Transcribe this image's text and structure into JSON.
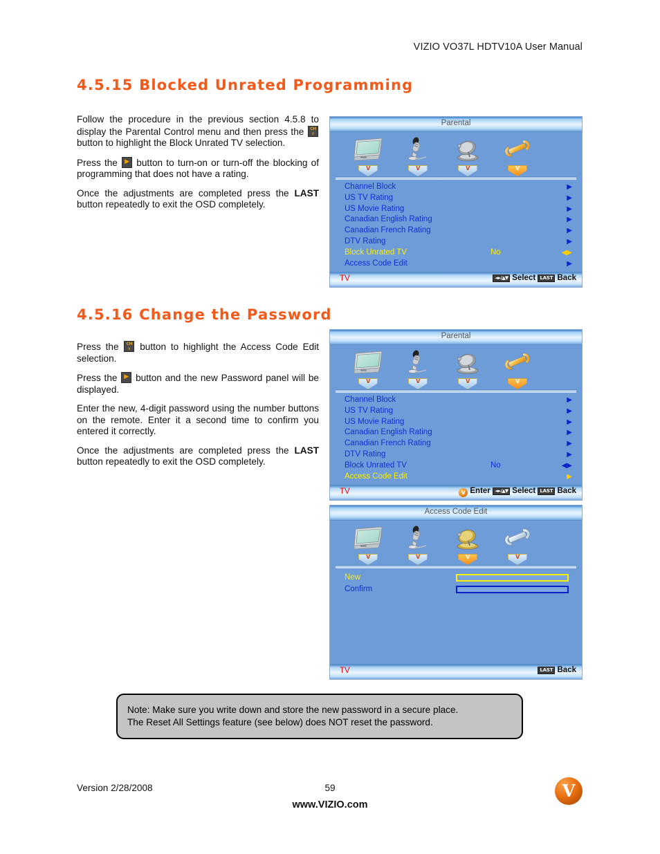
{
  "page_header": "VIZIO VO37L HDTV10A User Manual",
  "sections": [
    {
      "heading": "4.5.15 Blocked Unrated Programming",
      "paragraphs": [
        "Follow the procedure in the previous section 4.5.8 to display the Parental Control menu and then press the  button to highlight the Block Unrated TV selection.",
        "Press the  button to turn-on or turn-off the blocking of programming that does not have a rating.",
        "Once the adjustments are completed press the LAST button repeatedly to exit the OSD completely."
      ]
    },
    {
      "heading": "4.5.16 Change the Password",
      "paragraphs": [
        "Press the  button to highlight the Access Code Edit selection.",
        "Press the  button and the new Password panel will be displayed.",
        "Enter the new, 4-digit password using the number buttons on the remote.  Enter it a second time to confirm you entered it correctly.",
        "Once the adjustments are completed press the LAST button repeatedly to exit the OSD completely."
      ]
    }
  ],
  "text1": {
    "p1_a": "Follow the procedure in the previous section 4.5.8 to display the Parental Control menu and then press the",
    "p1_b": "button to highlight the Block Unrated TV selection.",
    "p2_a": "Press the",
    "p2_b": "button to turn-on or turn-off the blocking of programming that does not have a rating.",
    "p3_a": "Once the adjustments are completed press the",
    "p3_bold": "LAST",
    "p3_b": "button repeatedly to exit the OSD completely."
  },
  "text2": {
    "p1_a": "Press the",
    "p1_b": "button to highlight the Access Code Edit selection.",
    "p2_a": "Press the",
    "p2_b": "button and the new Password panel will be displayed.",
    "p3": "Enter the new, 4-digit password using the number buttons on the remote.  Enter it a second time to confirm you entered it correctly.",
    "p4_a": "Once the adjustments are completed press the",
    "p4_bold": "LAST",
    "p4_b": "button repeatedly to exit the OSD completely."
  },
  "osd_common": {
    "icon_tabs": [
      "V",
      "V",
      "V",
      "V"
    ],
    "icons": [
      "tv-monitor-icon",
      "microphone-icon",
      "satellite-dish-icon",
      "wrench-icon"
    ],
    "status_tv": "TV",
    "key_arrows": "◄►/▲▼",
    "key_last": "LAST",
    "hint_select": "Select",
    "hint_back": "Back",
    "hint_enter": "Enter",
    "enter_glyph": "V"
  },
  "osd1": {
    "title": "Parental",
    "active_icon_index": 3,
    "rows": [
      {
        "label": "Channel Block",
        "value": "",
        "arrow": "▶",
        "selected": false
      },
      {
        "label": "US TV Rating",
        "value": "",
        "arrow": "▶",
        "selected": false
      },
      {
        "label": "US Movie Rating",
        "value": "",
        "arrow": "▶",
        "selected": false
      },
      {
        "label": "Canadian English Rating",
        "value": "",
        "arrow": "▶",
        "selected": false
      },
      {
        "label": "Canadian French Rating",
        "value": "",
        "arrow": "▶",
        "selected": false
      },
      {
        "label": "DTV Rating",
        "value": "",
        "arrow": "▶",
        "selected": false
      },
      {
        "label": "Block Unrated TV",
        "value": "No",
        "arrow": "◀▶",
        "selected": true
      },
      {
        "label": "Access Code Edit",
        "value": "",
        "arrow": "▶",
        "selected": false
      }
    ]
  },
  "osd2": {
    "title": "Parental",
    "active_icon_index": 3,
    "rows": [
      {
        "label": "Channel Block",
        "value": "",
        "arrow": "▶",
        "selected": false
      },
      {
        "label": "US TV Rating",
        "value": "",
        "arrow": "▶",
        "selected": false
      },
      {
        "label": "US Movie Rating",
        "value": "",
        "arrow": "▶",
        "selected": false
      },
      {
        "label": "Canadian English Rating",
        "value": "",
        "arrow": "▶",
        "selected": false
      },
      {
        "label": "Canadian French Rating",
        "value": "",
        "arrow": "▶",
        "selected": false
      },
      {
        "label": "DTV Rating",
        "value": "",
        "arrow": "▶",
        "selected": false
      },
      {
        "label": "Block Unrated TV",
        "value": "No",
        "arrow": "◀▶",
        "selected": false
      },
      {
        "label": "Access Code Edit",
        "value": "",
        "arrow": "▶",
        "selected": true
      }
    ]
  },
  "osd3": {
    "title": "Access Code Edit",
    "active_icon_index": 2,
    "rows": [
      {
        "label": "New",
        "selected": true,
        "field_color": "#FFF000"
      },
      {
        "label": "Confirm",
        "selected": false,
        "field_color": "#0a22c8"
      }
    ]
  },
  "note": {
    "line1": "Note: Make sure you write down and store the new password in a secure place.",
    "line2": "The Reset All Settings feature (see below) does NOT reset the password."
  },
  "footer": {
    "version": "Version 2/28/2008",
    "page_number": "59",
    "website": "www.VIZIO.com",
    "logo_letter": "V"
  },
  "colors": {
    "heading_orange": "#F15A1B",
    "osd_body_blue": "#6d9cd9",
    "osd_label_blue": "#1030cf",
    "osd_selected_yellow": "#FFF000",
    "status_tv_red": "#e01010",
    "note_gray": "#c4c4c4"
  }
}
